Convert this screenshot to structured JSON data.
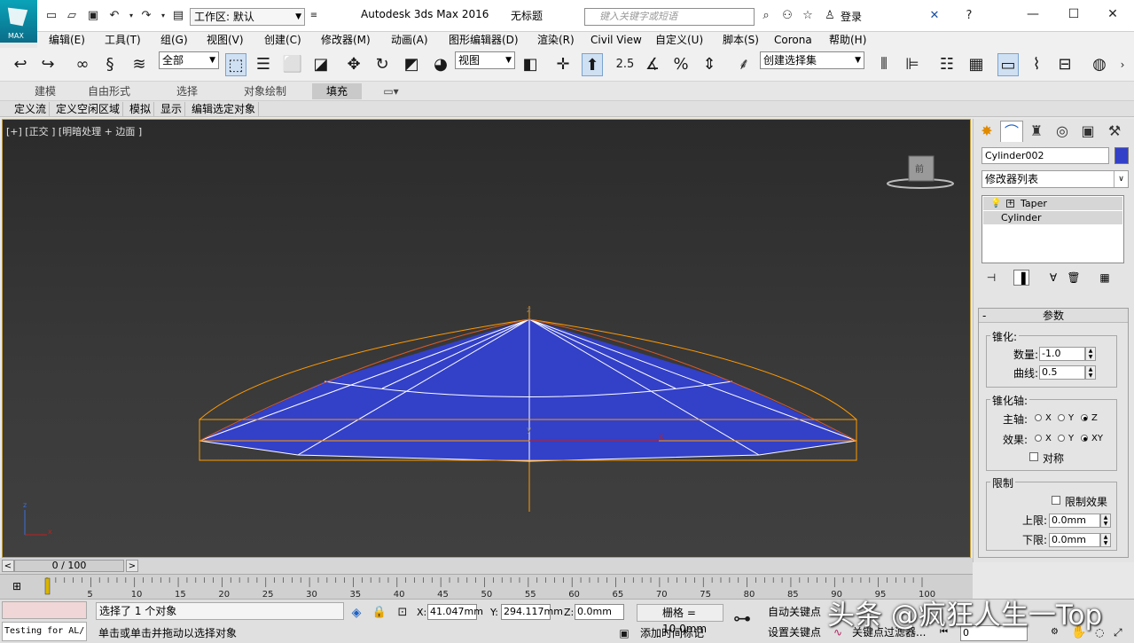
{
  "app": {
    "title": "Autodesk 3ds Max 2016",
    "doc_title": "无标题",
    "logo_text": "MAX",
    "workspace": "工作区: 默认",
    "search_placeholder": "键入关键字或短语",
    "login": "登录"
  },
  "menu": [
    "编辑(E)",
    "工具(T)",
    "组(G)",
    "视图(V)",
    "创建(C)",
    "修改器(M)",
    "动画(A)",
    "图形编辑器(D)",
    "渲染(R)",
    "Civil View",
    "自定义(U)",
    "脚本(S)",
    "Corona",
    "帮助(H)"
  ],
  "toolbar": {
    "selection_filter": "全部",
    "ref_coord": "视图",
    "named_selection": "创建选择集",
    "snap_label": "2.5"
  },
  "ribbon": {
    "tabs": [
      "建模",
      "自由形式",
      "选择",
      "对象绘制",
      "填充"
    ],
    "active_tab": "填充",
    "sub_tabs": [
      "定义流",
      "定义空闲区域",
      "模拟",
      "显示",
      "编辑选定对象"
    ]
  },
  "viewport": {
    "label": "[+] [正交 ] [明暗处理 + 边面 ]",
    "object_color": "#3340c8",
    "selection_color": "#ff9a00",
    "cube_label": "前"
  },
  "command_panel": {
    "object_name": "Cylinder002",
    "modifier_list": "修改器列表",
    "stack": [
      "Taper",
      "Cylinder"
    ],
    "rollout_title": "参数",
    "taper_group": "锥化:",
    "amount_label": "数量:",
    "amount_value": "-1.0",
    "curve_label": "曲线:",
    "curve_value": "0.5",
    "axis_group": "锥化轴:",
    "primary_label": "主轴:",
    "effect_label": "效果:",
    "primary_opts": [
      "X",
      "Y",
      "Z"
    ],
    "effect_opts": [
      "X",
      "Y",
      "XY"
    ],
    "symmetry_label": "对称",
    "limits_group": "限制",
    "limit_effect_label": "限制效果",
    "upper_label": "上限:",
    "upper_value": "0.0mm",
    "lower_label": "下限:",
    "lower_value": "0.0mm"
  },
  "timeline": {
    "frame_display": "0 / 100",
    "ticks": [
      "5",
      "10",
      "15",
      "20",
      "25",
      "30",
      "35",
      "40",
      "45",
      "50",
      "55",
      "60",
      "65",
      "70",
      "75",
      "80",
      "85",
      "90",
      "95",
      "100"
    ]
  },
  "status": {
    "listener_text": "Testing for AL/",
    "selection_text": "选择了 1 个对象",
    "prompt_text": "单击或单击并拖动以选择对象",
    "x_label": "X:",
    "x_value": "41.047mm",
    "y_label": "Y:",
    "y_value": "294.117mm",
    "z_label": "Z:",
    "z_value": "0.0mm",
    "grid_text": "栅格 = 10.0mm",
    "add_time_tag": "添加时间标记",
    "auto_key": "自动关键点",
    "set_key": "设置关键点",
    "key_filters": "关键点过滤器...",
    "current_frame": "0"
  },
  "watermark": "头条 @疯狂人生一Top"
}
